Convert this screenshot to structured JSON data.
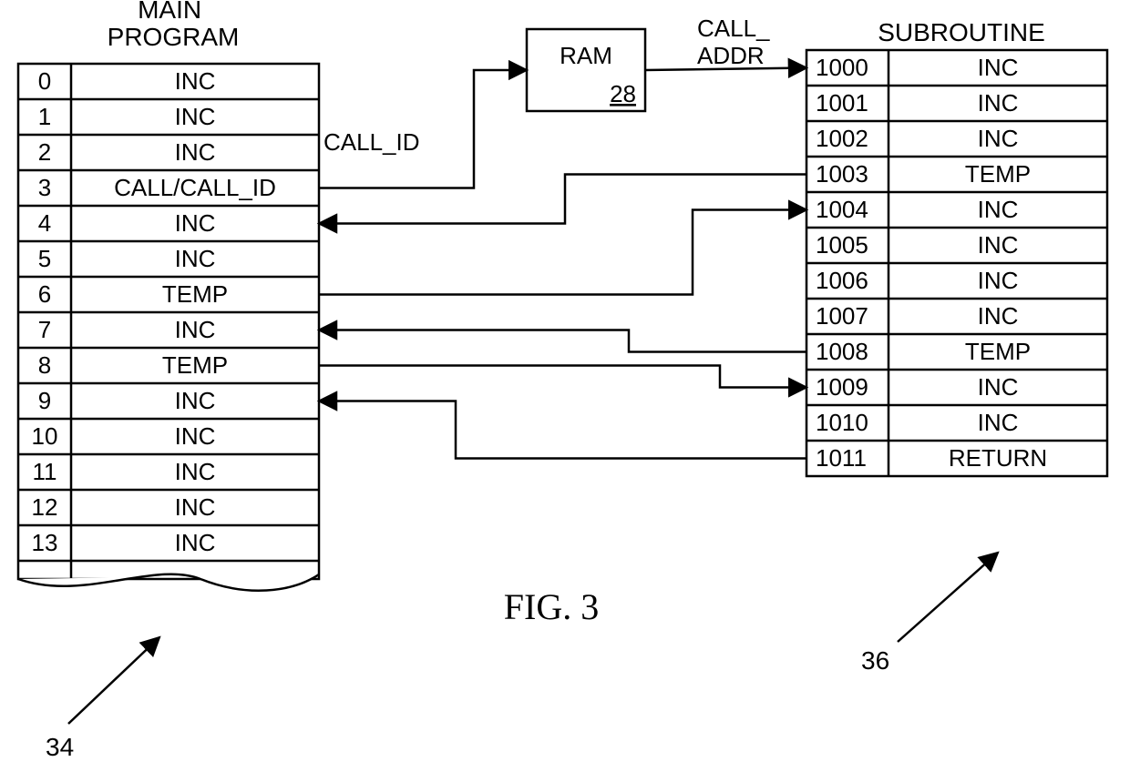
{
  "titles": {
    "main": "MAIN\nPROGRAM",
    "subroutine": "SUBROUTINE"
  },
  "figure_label": "FIG. 3",
  "labels": {
    "call_id": "CALL_ID",
    "call_addr": "CALL_\nADDR"
  },
  "ram": {
    "name": "RAM",
    "ref": "28"
  },
  "refs": {
    "main": "34",
    "subroutine": "36"
  },
  "main_program": [
    {
      "addr": "0",
      "op": "INC"
    },
    {
      "addr": "1",
      "op": "INC"
    },
    {
      "addr": "2",
      "op": "INC"
    },
    {
      "addr": "3",
      "op": "CALL/CALL_ID"
    },
    {
      "addr": "4",
      "op": "INC"
    },
    {
      "addr": "5",
      "op": "INC"
    },
    {
      "addr": "6",
      "op": "TEMP"
    },
    {
      "addr": "7",
      "op": "INC"
    },
    {
      "addr": "8",
      "op": "TEMP"
    },
    {
      "addr": "9",
      "op": "INC"
    },
    {
      "addr": "10",
      "op": "INC"
    },
    {
      "addr": "11",
      "op": "INC"
    },
    {
      "addr": "12",
      "op": "INC"
    },
    {
      "addr": "13",
      "op": "INC"
    }
  ],
  "subroutine": [
    {
      "addr": "1000",
      "op": "INC"
    },
    {
      "addr": "1001",
      "op": "INC"
    },
    {
      "addr": "1002",
      "op": "INC"
    },
    {
      "addr": "1003",
      "op": "TEMP"
    },
    {
      "addr": "1004",
      "op": "INC"
    },
    {
      "addr": "1005",
      "op": "INC"
    },
    {
      "addr": "1006",
      "op": "INC"
    },
    {
      "addr": "1007",
      "op": "INC"
    },
    {
      "addr": "1008",
      "op": "TEMP"
    },
    {
      "addr": "1009",
      "op": "INC"
    },
    {
      "addr": "1010",
      "op": "INC"
    },
    {
      "addr": "1011",
      "op": "RETURN"
    }
  ]
}
